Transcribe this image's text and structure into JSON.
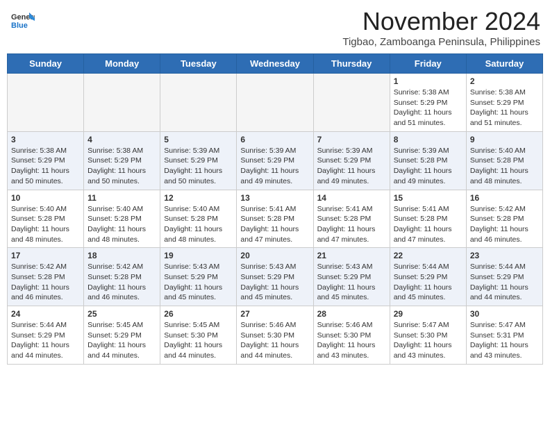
{
  "header": {
    "logo_line1": "General",
    "logo_line2": "Blue",
    "month_title": "November 2024",
    "subtitle": "Tigbao, Zamboanga Peninsula, Philippines"
  },
  "weekdays": [
    "Sunday",
    "Monday",
    "Tuesday",
    "Wednesday",
    "Thursday",
    "Friday",
    "Saturday"
  ],
  "weeks": [
    [
      {
        "day": "",
        "info": ""
      },
      {
        "day": "",
        "info": ""
      },
      {
        "day": "",
        "info": ""
      },
      {
        "day": "",
        "info": ""
      },
      {
        "day": "",
        "info": ""
      },
      {
        "day": "1",
        "info": "Sunrise: 5:38 AM\nSunset: 5:29 PM\nDaylight: 11 hours\nand 51 minutes."
      },
      {
        "day": "2",
        "info": "Sunrise: 5:38 AM\nSunset: 5:29 PM\nDaylight: 11 hours\nand 51 minutes."
      }
    ],
    [
      {
        "day": "3",
        "info": "Sunrise: 5:38 AM\nSunset: 5:29 PM\nDaylight: 11 hours\nand 50 minutes."
      },
      {
        "day": "4",
        "info": "Sunrise: 5:38 AM\nSunset: 5:29 PM\nDaylight: 11 hours\nand 50 minutes."
      },
      {
        "day": "5",
        "info": "Sunrise: 5:39 AM\nSunset: 5:29 PM\nDaylight: 11 hours\nand 50 minutes."
      },
      {
        "day": "6",
        "info": "Sunrise: 5:39 AM\nSunset: 5:29 PM\nDaylight: 11 hours\nand 49 minutes."
      },
      {
        "day": "7",
        "info": "Sunrise: 5:39 AM\nSunset: 5:29 PM\nDaylight: 11 hours\nand 49 minutes."
      },
      {
        "day": "8",
        "info": "Sunrise: 5:39 AM\nSunset: 5:28 PM\nDaylight: 11 hours\nand 49 minutes."
      },
      {
        "day": "9",
        "info": "Sunrise: 5:40 AM\nSunset: 5:28 PM\nDaylight: 11 hours\nand 48 minutes."
      }
    ],
    [
      {
        "day": "10",
        "info": "Sunrise: 5:40 AM\nSunset: 5:28 PM\nDaylight: 11 hours\nand 48 minutes."
      },
      {
        "day": "11",
        "info": "Sunrise: 5:40 AM\nSunset: 5:28 PM\nDaylight: 11 hours\nand 48 minutes."
      },
      {
        "day": "12",
        "info": "Sunrise: 5:40 AM\nSunset: 5:28 PM\nDaylight: 11 hours\nand 48 minutes."
      },
      {
        "day": "13",
        "info": "Sunrise: 5:41 AM\nSunset: 5:28 PM\nDaylight: 11 hours\nand 47 minutes."
      },
      {
        "day": "14",
        "info": "Sunrise: 5:41 AM\nSunset: 5:28 PM\nDaylight: 11 hours\nand 47 minutes."
      },
      {
        "day": "15",
        "info": "Sunrise: 5:41 AM\nSunset: 5:28 PM\nDaylight: 11 hours\nand 47 minutes."
      },
      {
        "day": "16",
        "info": "Sunrise: 5:42 AM\nSunset: 5:28 PM\nDaylight: 11 hours\nand 46 minutes."
      }
    ],
    [
      {
        "day": "17",
        "info": "Sunrise: 5:42 AM\nSunset: 5:28 PM\nDaylight: 11 hours\nand 46 minutes."
      },
      {
        "day": "18",
        "info": "Sunrise: 5:42 AM\nSunset: 5:28 PM\nDaylight: 11 hours\nand 46 minutes."
      },
      {
        "day": "19",
        "info": "Sunrise: 5:43 AM\nSunset: 5:29 PM\nDaylight: 11 hours\nand 45 minutes."
      },
      {
        "day": "20",
        "info": "Sunrise: 5:43 AM\nSunset: 5:29 PM\nDaylight: 11 hours\nand 45 minutes."
      },
      {
        "day": "21",
        "info": "Sunrise: 5:43 AM\nSunset: 5:29 PM\nDaylight: 11 hours\nand 45 minutes."
      },
      {
        "day": "22",
        "info": "Sunrise: 5:44 AM\nSunset: 5:29 PM\nDaylight: 11 hours\nand 45 minutes."
      },
      {
        "day": "23",
        "info": "Sunrise: 5:44 AM\nSunset: 5:29 PM\nDaylight: 11 hours\nand 44 minutes."
      }
    ],
    [
      {
        "day": "24",
        "info": "Sunrise: 5:44 AM\nSunset: 5:29 PM\nDaylight: 11 hours\nand 44 minutes."
      },
      {
        "day": "25",
        "info": "Sunrise: 5:45 AM\nSunset: 5:29 PM\nDaylight: 11 hours\nand 44 minutes."
      },
      {
        "day": "26",
        "info": "Sunrise: 5:45 AM\nSunset: 5:30 PM\nDaylight: 11 hours\nand 44 minutes."
      },
      {
        "day": "27",
        "info": "Sunrise: 5:46 AM\nSunset: 5:30 PM\nDaylight: 11 hours\nand 44 minutes."
      },
      {
        "day": "28",
        "info": "Sunrise: 5:46 AM\nSunset: 5:30 PM\nDaylight: 11 hours\nand 43 minutes."
      },
      {
        "day": "29",
        "info": "Sunrise: 5:47 AM\nSunset: 5:30 PM\nDaylight: 11 hours\nand 43 minutes."
      },
      {
        "day": "30",
        "info": "Sunrise: 5:47 AM\nSunset: 5:31 PM\nDaylight: 11 hours\nand 43 minutes."
      }
    ]
  ]
}
